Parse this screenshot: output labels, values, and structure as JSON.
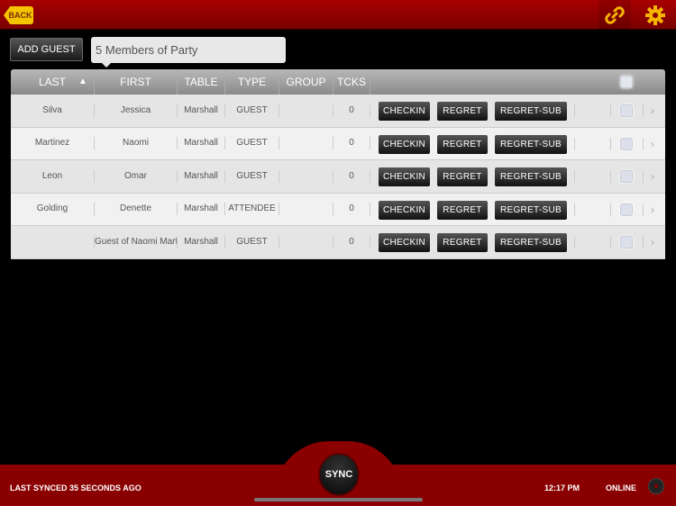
{
  "header": {
    "back_label": "BACK",
    "link_icon": "link-icon",
    "settings_icon": "gear-icon"
  },
  "toolbar": {
    "add_guest_label": "ADD GUEST",
    "party_label": "5 Members of Party"
  },
  "table": {
    "columns": [
      "LAST",
      "FIRST",
      "TABLE",
      "TYPE",
      "GROUP ID",
      "TCKS"
    ],
    "sort": {
      "column": "LAST",
      "direction": "ascending"
    },
    "action_labels": [
      "CHECKIN",
      "REGRET",
      "REGRET-SUB"
    ],
    "rows": [
      {
        "last": "Silva",
        "first": "Jessica",
        "table": "Marshall",
        "type": "GUEST",
        "group_id": "",
        "tcks": "0"
      },
      {
        "last": "Martinez",
        "first": "Naomi",
        "table": "Marshall",
        "type": "GUEST",
        "group_id": "",
        "tcks": "0"
      },
      {
        "last": "Leon",
        "first": "Omar",
        "table": "Marshall",
        "type": "GUEST",
        "group_id": "",
        "tcks": "0"
      },
      {
        "last": "Golding",
        "first": "Denette",
        "table": "Marshall",
        "type": "ATTENDEE",
        "group_id": "",
        "tcks": "0"
      },
      {
        "last": "",
        "first": "Guest of Naomi Mart",
        "table": "Marshall",
        "type": "GUEST",
        "group_id": "",
        "tcks": "0"
      }
    ]
  },
  "footer": {
    "last_synced": "LAST SYNCED 35 SECONDS AGO",
    "sync_label": "SYNC",
    "time": "12:17 PM",
    "status": "ONLINE"
  },
  "colors": {
    "brand_red": "#8a0000",
    "accent_yellow": "#f5c400"
  }
}
